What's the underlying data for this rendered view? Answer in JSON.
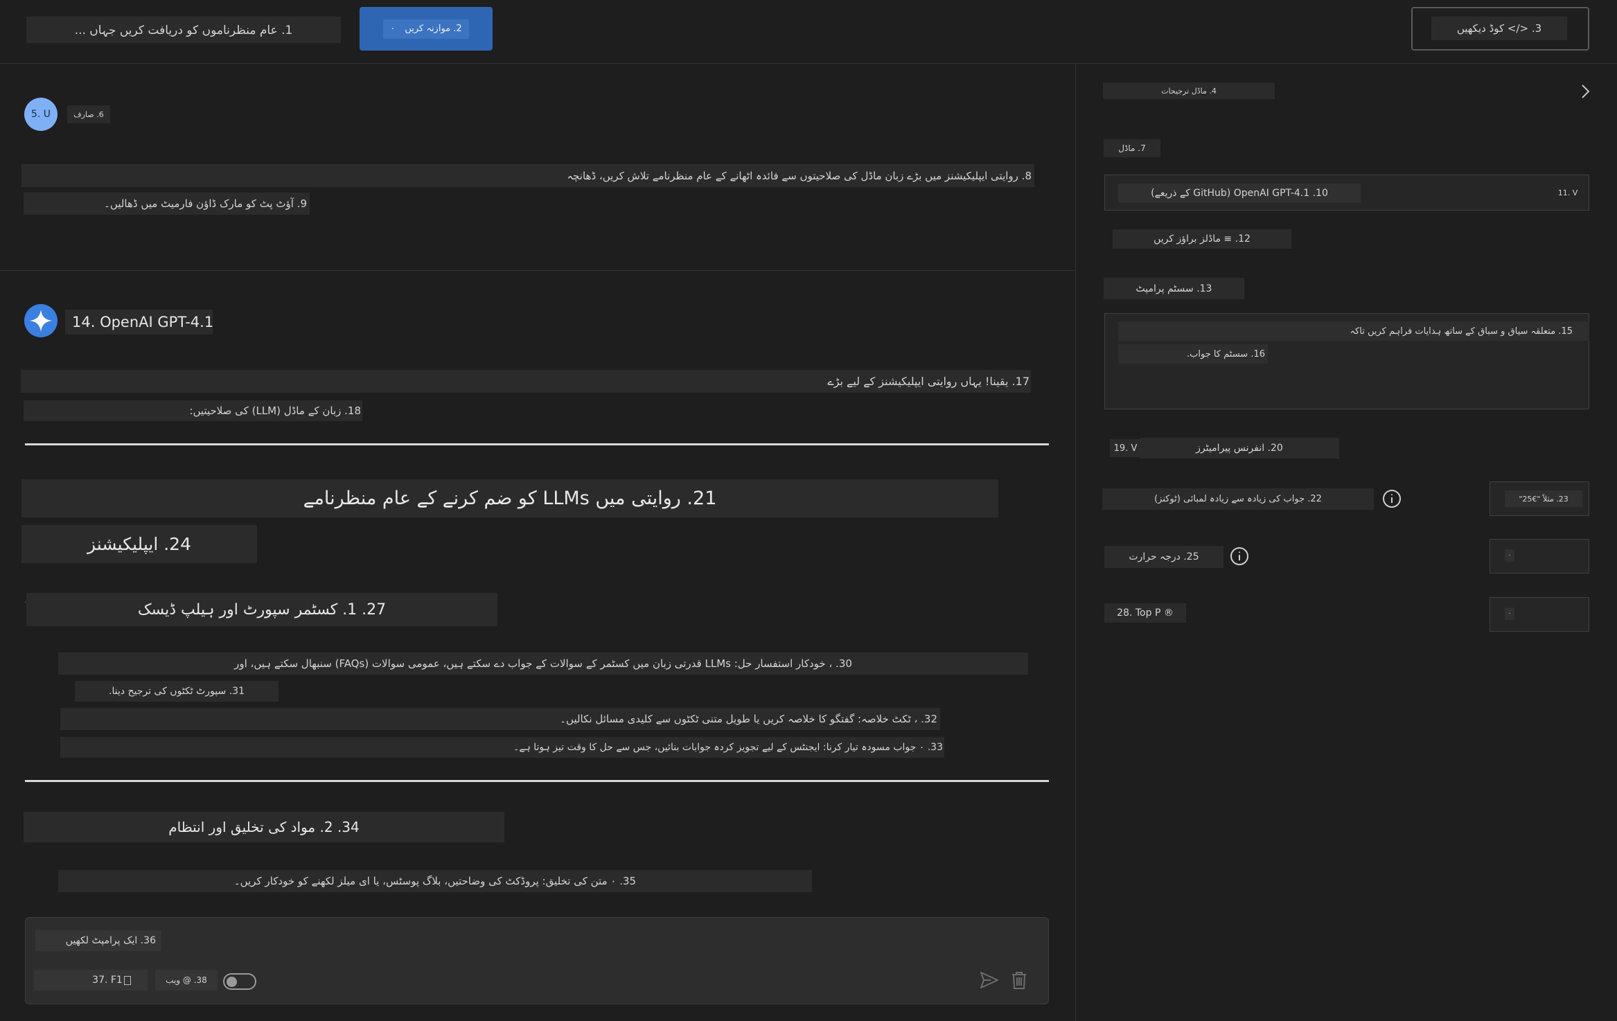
{
  "header": {
    "query": "1. عام منظرناموں کو دریافت کریں جہاں ...",
    "compare_button": "2. موازنہ کریں",
    "compare_suffix": "٠",
    "view_code_button": "3. </> کوڈ دیکھیں"
  },
  "user_message": {
    "avatar": "5. U",
    "role": "6. صارف",
    "line1": "8. روایتی ایپلیکیشنز میں بڑے زبان ماڈل کی صلاحیتوں سے فائدہ اٹھانے کے عام منظرنامے تلاش کریں، ڈھانچہ",
    "line2": "9. آؤٹ پٹ کو مارک ڈاؤن فارمیٹ میں ڈھالیں۔"
  },
  "assistant_message": {
    "model_name": "14. OpenAI GPT-4.1",
    "intro1": "17. یقینا! یہاں روایتی ایپلیکیشنز کے لیے بڑے",
    "intro2": "18. زبان کے ماڈل (LLM) کی صلاحیتیں:",
    "heading": "21. روایتی میں LLMs کو ضم کرنے کے عام منظرنامے",
    "subheading": "24. ایپلیکیشنز",
    "section1_title": "27. 1. کسٹمر سپورٹ اور ہیلپ ڈیسک",
    "section1_marker": "٠",
    "item30": "30. ، خودکار استفسار حل: LLMs قدرتی زبان میں کسٹمر کے سوالات کے جواب دے سکتے ہیں، عمومی سوالات (FAQs) سنبھال سکتے ہیں، اور",
    "item31": "31. سپورٹ ٹکٹوں کی ترجیح دینا.",
    "item32": "32. ، ٹکٹ خلاصہ: گفتگو کا خلاصہ کریں یا طویل متنی ٹکٹوں سے کلیدی مسائل نکالیں۔",
    "item33": "33. ٠ جواب مسودہ تیار کرنا: ایجنٹس کے لیے تجویز کردہ جوابات بنائیں، جس سے حل کا وقت تیز ہوتا ہے۔",
    "section2_title": "34. 2. مواد کی تخلیق اور انتظام",
    "item35": "35. ٠ متن کی تخلیق: پروڈکٹ کی وضاحتیں، بلاگ پوسٹس، یا ای میلز لکھنے کو خودکار کریں۔"
  },
  "composer": {
    "placeholder": "36. ایک پرامپٹ لکھیں",
    "file_chip": "37. F1",
    "web_label": "38. @ ویب"
  },
  "settings": {
    "title": "4. ماڈل ترجیحات",
    "model_label": "7. ماڈل",
    "model_value": "10. OpenAI GPT-4.1 (GitHub کے ذریعے)",
    "model_version": "11. V",
    "browse_models": "12. ≡ ماڈلز براؤز کریں",
    "system_prompt_label": "13. سسٹم پرامپٹ",
    "system_prompt_text": "15. متعلقہ سیاق و سباق کے ساتھ ہدایات فراہم کریں تاکہ",
    "system_prompt_text2": "16. سسٹم کا جواب.",
    "inference_toggle": "19. V",
    "inference_label": "20. انفرنس پیرامیٹرز",
    "max_tokens_label": "22. جواب کی زیادہ سے زیادہ لمبائی (ٹوکنز)",
    "max_tokens_value": "23. مثلاً \"€25\"",
    "temperature_label": "25. درجہ حرارت",
    "temperature_value": "٠",
    "top_p_label": "28. Top P ®",
    "top_p_value": "٠"
  },
  "colors": {
    "background": "#1e1e1e",
    "panel": "#2b2b2b",
    "accent": "#2f66b3",
    "avatar": "#7fb0f5"
  }
}
